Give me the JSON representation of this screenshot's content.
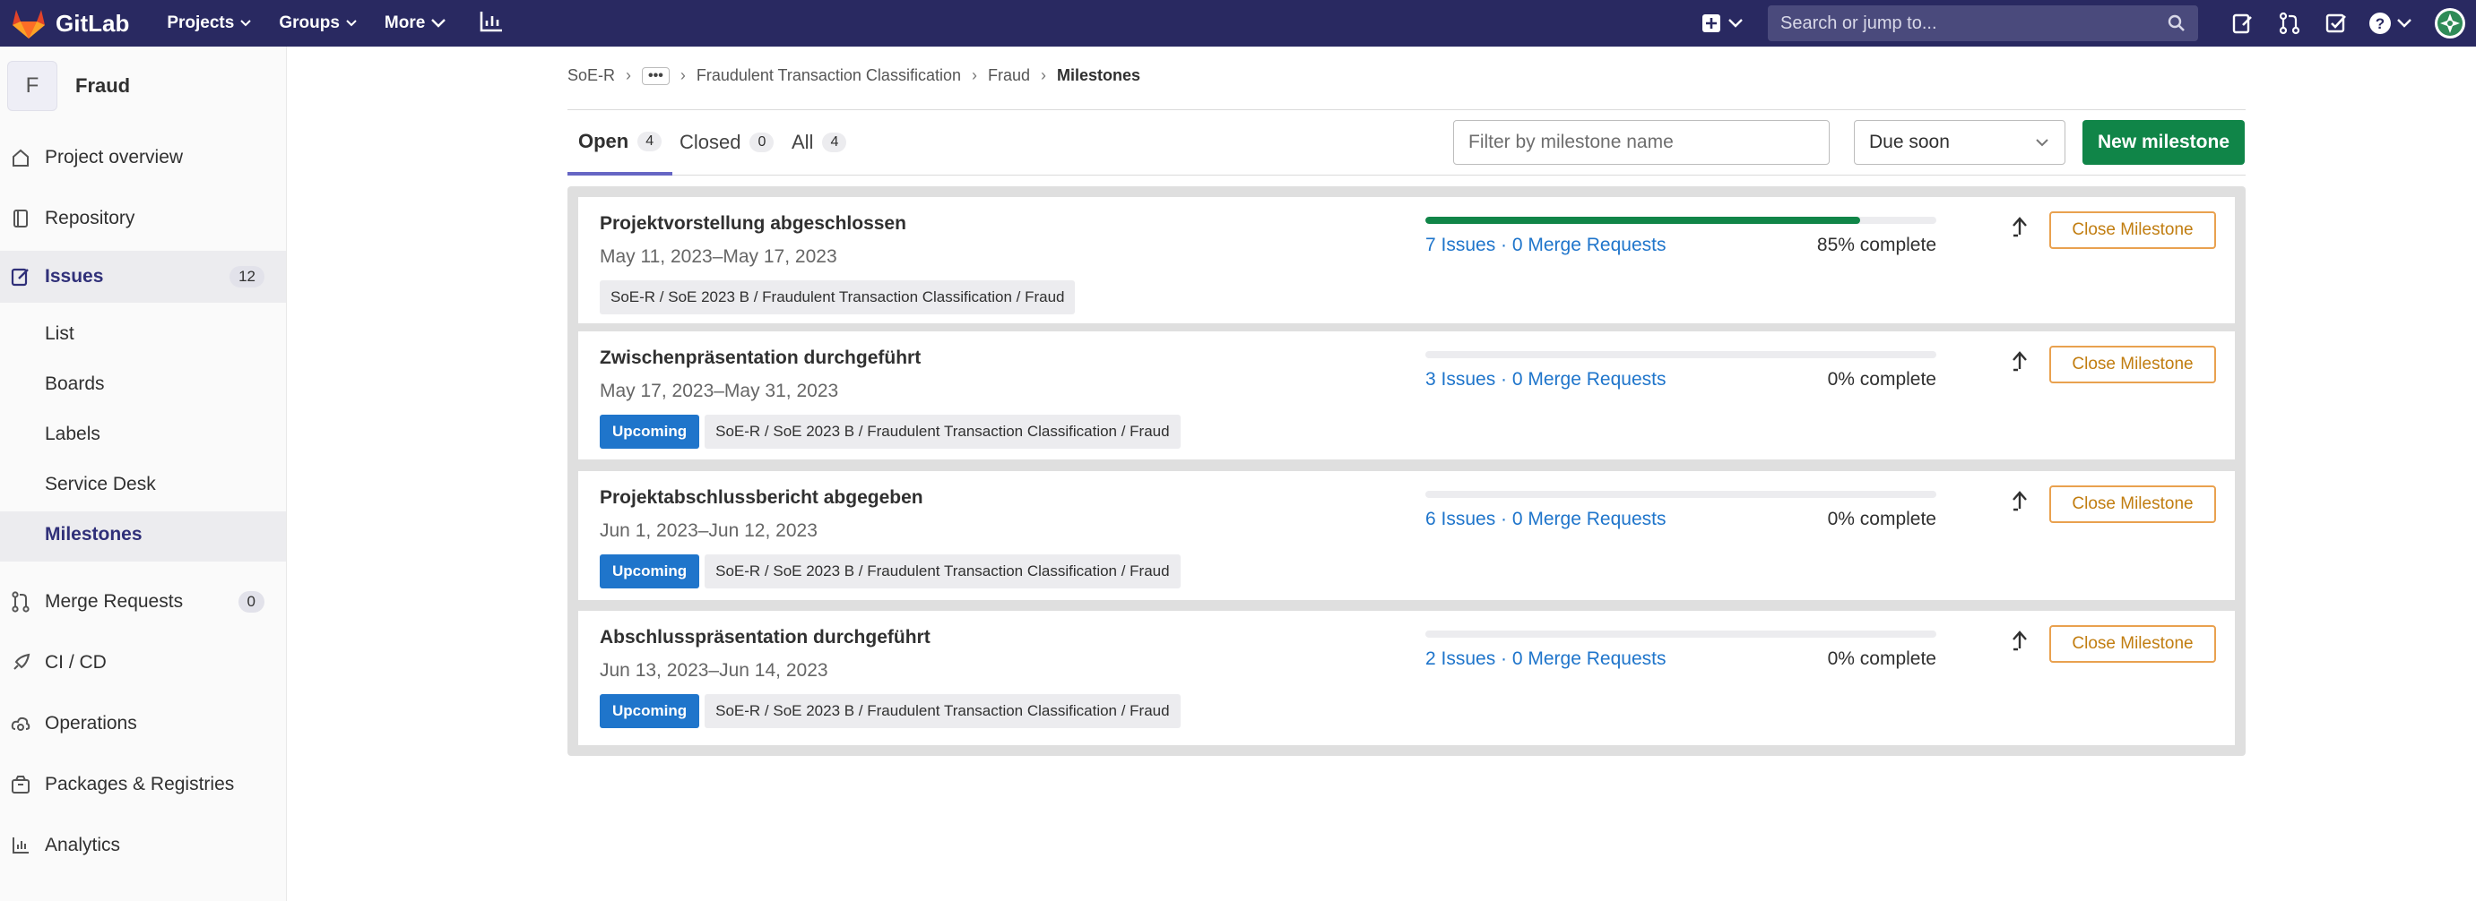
{
  "topnav": {
    "brand": "GitLab",
    "menu": [
      {
        "label": "Projects"
      },
      {
        "label": "Groups"
      },
      {
        "label": "More"
      }
    ],
    "search_placeholder": "Search or jump to..."
  },
  "sidebar": {
    "project_initial": "F",
    "project_name": "Fraud",
    "items": [
      {
        "label": "Project overview",
        "icon": "home-icon"
      },
      {
        "label": "Repository",
        "icon": "book-icon"
      },
      {
        "label": "Issues",
        "icon": "issues-icon",
        "count": "12"
      },
      {
        "label": "Merge Requests",
        "icon": "merge-request-icon",
        "count": "0"
      },
      {
        "label": "CI / CD",
        "icon": "rocket-icon"
      },
      {
        "label": "Operations",
        "icon": "cloud-gear-icon"
      },
      {
        "label": "Packages & Registries",
        "icon": "package-icon"
      },
      {
        "label": "Analytics",
        "icon": "analytics-icon"
      }
    ],
    "issues_sub": [
      "List",
      "Boards",
      "Labels",
      "Service Desk",
      "Milestones"
    ]
  },
  "breadcrumb": {
    "root": "SoE-R",
    "ellipsis": "•••",
    "items": [
      "Fraudulent Transaction Classification",
      "Fraud"
    ],
    "current": "Milestones"
  },
  "tabs": [
    {
      "label": "Open",
      "count": "4"
    },
    {
      "label": "Closed",
      "count": "0"
    },
    {
      "label": "All",
      "count": "4"
    }
  ],
  "filter": {
    "placeholder": "Filter by milestone name"
  },
  "sort": {
    "selected": "Due soon"
  },
  "new_milestone_label": "New milestone",
  "close_label": "Close Milestone",
  "milestones": [
    {
      "title": "Projektvorstellung abgeschlossen",
      "dates": "May 11, 2023–May 17, 2023",
      "upcoming": "",
      "path": "SoE-R / SoE 2023 B / Fraudulent Transaction Classification / Fraud",
      "links": "7 Issues · 0 Merge Requests",
      "complete": "85% complete",
      "progress": 0.85
    },
    {
      "title": "Zwischenpräsentation durchgeführt",
      "dates": "May 17, 2023–May 31, 2023",
      "upcoming": "Upcoming",
      "path": "SoE-R / SoE 2023 B / Fraudulent Transaction Classification / Fraud",
      "links": "3 Issues · 0 Merge Requests",
      "complete": "0% complete",
      "progress": 0
    },
    {
      "title": "Projektabschlussbericht abgegeben",
      "dates": "Jun 1, 2023–Jun 12, 2023",
      "upcoming": "Upcoming",
      "path": "SoE-R / SoE 2023 B / Fraudulent Transaction Classification / Fraud",
      "links": "6 Issues · 0 Merge Requests",
      "complete": "0% complete",
      "progress": 0
    },
    {
      "title": "Abschlusspräsentation durchgeführt",
      "dates": "Jun 13, 2023–Jun 14, 2023",
      "upcoming": "Upcoming",
      "path": "SoE-R / SoE 2023 B / Fraudulent Transaction Classification / Fraud",
      "links": "2 Issues · 0 Merge Requests",
      "complete": "0% complete",
      "progress": 0
    }
  ],
  "colors": {
    "nav_bg": "#292961",
    "primary_green": "#108548",
    "link_blue": "#1f75cb",
    "warning_orange": "#e9a14f"
  }
}
